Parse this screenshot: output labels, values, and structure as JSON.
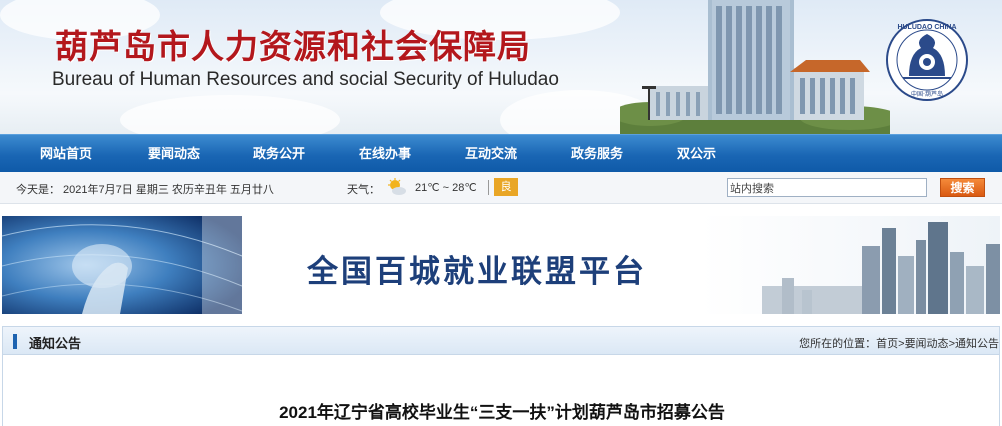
{
  "header": {
    "title_cn": "葫芦岛市人力资源和社会保障局",
    "title_en": "Bureau of Human Resources and social Security of Huludao",
    "emblem_text_top": "HULUDAO CHINA",
    "emblem_text_bottom": "中国·葫芦岛"
  },
  "nav": {
    "items": [
      "网站首页",
      "要闻动态",
      "政务公开",
      "在线办事",
      "互动交流",
      "政务服务",
      "双公示"
    ]
  },
  "infobar": {
    "date": "今天是： 2021年7月7日 星期三 农历辛丑年 五月廿八",
    "weather_label": "天气：",
    "weather_icon": "sun-cloud-icon",
    "temperature": "21℃ ~ 28℃",
    "air_quality": "良",
    "search_placeholder": "站内搜索",
    "search_button": "搜索"
  },
  "promo": {
    "text": "全国百城就业联盟平台"
  },
  "section": {
    "title": "通知公告",
    "breadcrumb_prefix": "您所在的位置：",
    "crumbs": [
      "首页",
      "要闻动态",
      "通知公告"
    ]
  },
  "article": {
    "title": "2021年辽宁省高校毕业生“三支一扶”计划葫芦岛市招募公告"
  },
  "colors": {
    "title_red": "#b3171c",
    "nav_blue": "#1a66b4",
    "search_orange": "#e26a1e",
    "air_badge": "#e9a626"
  }
}
